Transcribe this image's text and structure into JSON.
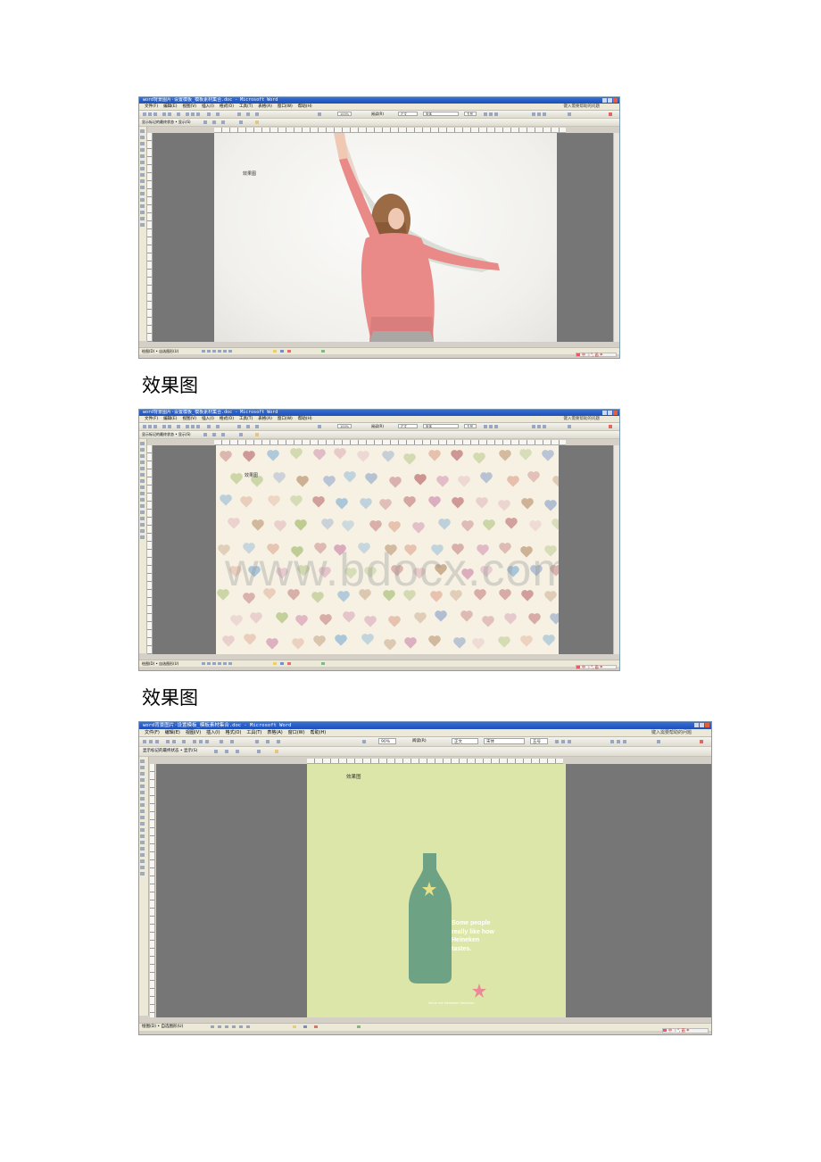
{
  "screenshots": [
    {
      "title": "word背景图片·设置模板_模板素材集合.doc - Microsoft Word",
      "menus": [
        "文件(F)",
        "编辑(E)",
        "视图(V)",
        "插入(I)",
        "格式(O)",
        "工具(T)",
        "表格(A)",
        "窗口(W)",
        "帮助(H)"
      ],
      "help_box": "键入需要帮助的问题",
      "zoom": "100%",
      "style": "正文",
      "font": "宋体",
      "font_size": "五号",
      "reading_label": "阅读(R)",
      "review_bar": "显示标记的最终状态 • 显示(S)",
      "page_text": "效果图",
      "draw_label": "绘图(D) • 自选图形(U)",
      "ime": "中 ☽ °, 画 ☂",
      "background": "photo-girl-pink-sweater"
    },
    {
      "title": "word背景图片·设置模板_模板素材集合.doc - Microsoft Word",
      "menus": [
        "文件(F)",
        "编辑(E)",
        "视图(V)",
        "插入(I)",
        "格式(O)",
        "工具(T)",
        "表格(A)",
        "窗口(W)",
        "帮助(H)"
      ],
      "help_box": "键入需要帮助的问题",
      "zoom": "100%",
      "style": "正文",
      "font": "宋体",
      "font_size": "五号",
      "reading_label": "阅读(R)",
      "review_bar": "显示标记的最终状态 • 显示(S)",
      "page_text": "效果图",
      "watermark": "www.bdocx.com",
      "draw_label": "绘图(D) • 自选图形(U)",
      "ime": "中 ☽ °, 画 ☂",
      "background": "pastel-hearts"
    },
    {
      "title": "word背景图片·设置模板_模板素材集合.doc - Microsoft Word",
      "menus": [
        "文件(F)",
        "编辑(E)",
        "视图(V)",
        "插入(I)",
        "格式(O)",
        "工具(T)",
        "表格(A)",
        "窗口(W)",
        "帮助(H)"
      ],
      "help_box": "键入需要帮助的问题",
      "zoom": "90%",
      "style": "正文",
      "font": "宋体",
      "font_size": "五号",
      "reading_label": "阅读(R)",
      "review_bar": "显示标记的最终状态 • 显示(S)",
      "page_text": "效果图",
      "ad_text": [
        "Some people",
        "really like how",
        "Heineken",
        "tastes."
      ],
      "ad_footer": "Serve me Heineken Heineken",
      "draw_label": "绘图(D) • 自选图形(U)",
      "ime": "中 ☽ °, 画 ☂",
      "background": "heineken-green-bottle"
    }
  ],
  "captions": [
    "效果图",
    "效果图"
  ],
  "colors": {
    "titlebar": "#1c4fb8",
    "workspace": "#767676",
    "hearts_bg": "#f6f1e3",
    "heineken_bg": "#dde6a9",
    "bottle": "#6ea284"
  }
}
